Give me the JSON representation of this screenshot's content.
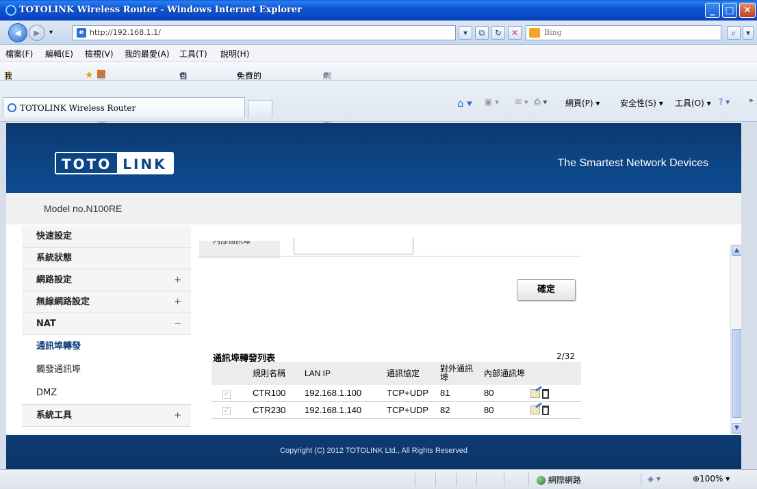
{
  "window": {
    "title": "TOTOLINK Wireless Router - Windows Internet Explorer"
  },
  "address_bar": {
    "url": "http://192.168.1.1/",
    "search_placeholder": "Bing"
  },
  "menu": [
    "檔案(F)",
    "編輯(E)",
    "檢視(V)",
    "我的最愛(A)",
    "工具(T)",
    "說明(H)"
  ],
  "favorites_bar": {
    "favorites_label": "我的最愛",
    "suggested_sites": "建議的網站 ▾",
    "custom_links": "自訂連結",
    "hotmail": "免費的 Hotmail",
    "web_slice": "網頁快訊圖庫 ▾"
  },
  "tab": {
    "title": "TOTOLINK Wireless Router"
  },
  "command_bar": {
    "page": "網頁(P) ▾",
    "safety": "安全性(S) ▾",
    "tools": "工具(O) ▾"
  },
  "router": {
    "logo_left": "TOTO",
    "logo_right": "LINK",
    "slogan": "The Smartest Network Devices",
    "model": "Model no.N100RE",
    "copyright": "Copyright (C) 2012  TOTOLINK Ltd.,  All Rights Reserved"
  },
  "sidebar": {
    "items": [
      {
        "label": "快速設定",
        "expander": ""
      },
      {
        "label": "系統狀態",
        "expander": ""
      },
      {
        "label": "網路設定",
        "expander": "+"
      },
      {
        "label": "無線網路設定",
        "expander": "+"
      },
      {
        "label": "NAT",
        "expander": "−"
      },
      {
        "label": "通訊埠轉發",
        "expander": ""
      },
      {
        "label": "觸發通訊埠",
        "expander": ""
      },
      {
        "label": "DMZ",
        "expander": ""
      },
      {
        "label": "系統工具",
        "expander": "+"
      }
    ]
  },
  "form": {
    "cut_label": "內部通訊埠",
    "confirm_button": "確定"
  },
  "port_forward_table": {
    "title": "通訊埠轉發列表",
    "count": "2/32",
    "headers": [
      "",
      "規則名稱",
      "LAN IP",
      "通訊協定",
      "對外通訊埠",
      "內部通訊埠",
      ""
    ],
    "rows": [
      {
        "name": "CTR100",
        "lan_ip": "192.168.1.100",
        "protocol": "TCP+UDP",
        "external_port": "81",
        "internal_port": "80"
      },
      {
        "name": "CTR230",
        "lan_ip": "192.168.1.140",
        "protocol": "TCP+UDP",
        "external_port": "82",
        "internal_port": "80"
      }
    ]
  },
  "status_bar": {
    "zone": "網際網路",
    "zoom": "100%"
  }
}
